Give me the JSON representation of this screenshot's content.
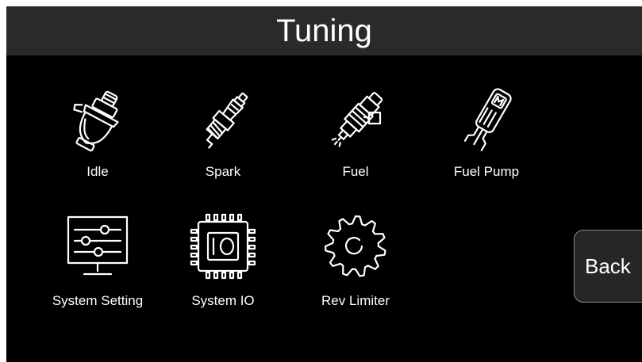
{
  "header": {
    "title": "Tuning"
  },
  "tiles": [
    {
      "label": "Idle",
      "icon": "idle-air-valve-icon"
    },
    {
      "label": "Spark",
      "icon": "spark-plug-icon"
    },
    {
      "label": "Fuel",
      "icon": "fuel-injector-icon"
    },
    {
      "label": "Fuel Pump",
      "icon": "fuel-pump-icon"
    },
    {
      "label": "System Setting",
      "icon": "settings-monitor-icon"
    },
    {
      "label": "System IO",
      "icon": "io-chip-icon"
    },
    {
      "label": "Rev Limiter",
      "icon": "gear-icon"
    }
  ],
  "back": {
    "label": "Back"
  },
  "colors": {
    "background": "#000000",
    "header": "#2a2a2a",
    "text": "#ffffff",
    "button": "#262626",
    "button_border": "#8a8a8a"
  }
}
